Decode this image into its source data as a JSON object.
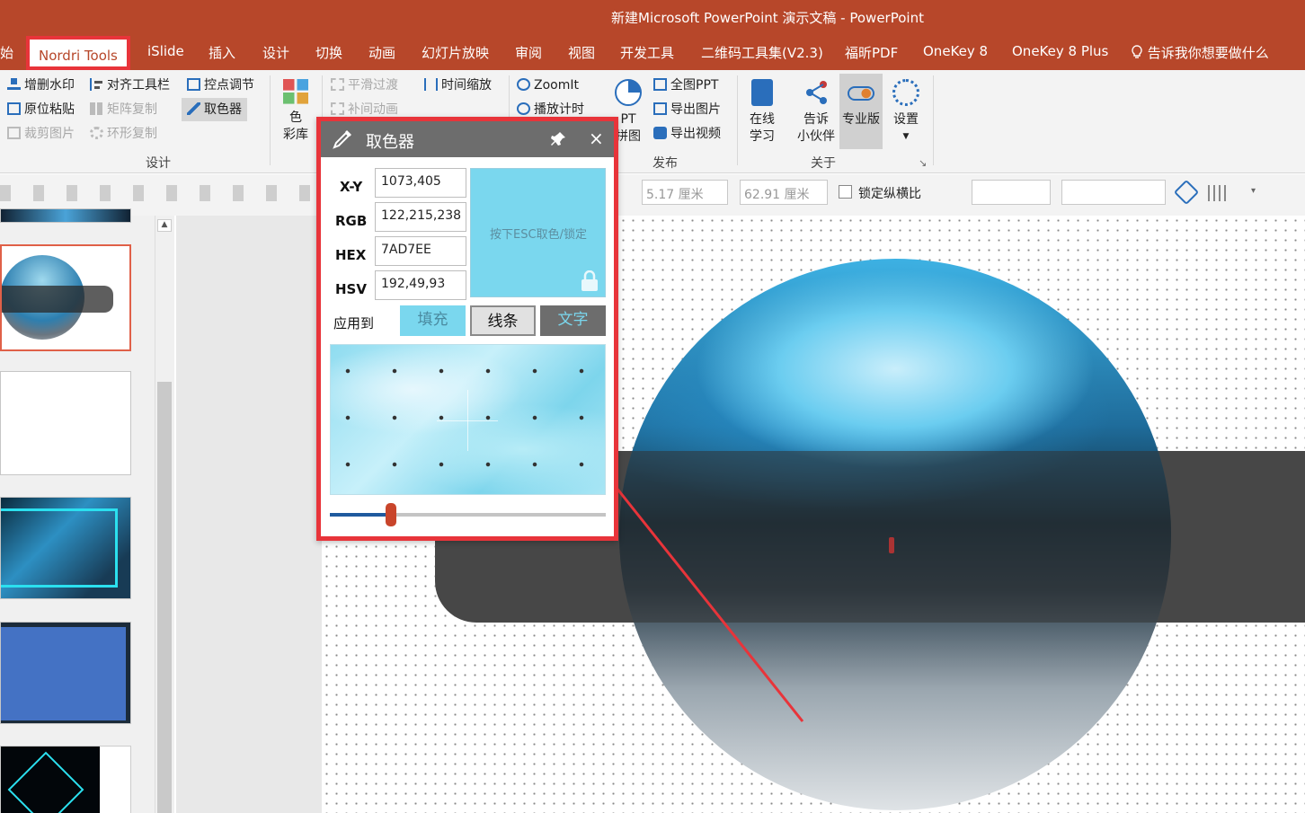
{
  "window": {
    "title": "新建Microsoft PowerPoint 演示文稿  -  PowerPoint"
  },
  "tabs": [
    "始",
    "Nordri Tools",
    "iSlide",
    "插入",
    "设计",
    "切换",
    "动画",
    "幻灯片放映",
    "审阅",
    "视图",
    "开发工具",
    "二维码工具集(V2.3)",
    "福昕PDF",
    "OneKey 8",
    "OneKey 8 Plus"
  ],
  "tell_me": "告诉我你想要做什么",
  "ribbon": {
    "design_col1": [
      "增删水印",
      "原位粘贴",
      "裁剪图片"
    ],
    "design_col2": [
      "对齐工具栏",
      "矩阵复制",
      "环形复制"
    ],
    "design_col3": [
      "控点调节",
      "取色器"
    ],
    "color_lib": [
      "色",
      "彩库"
    ],
    "design_group": "设计",
    "anim_col1": [
      "平滑过渡",
      "补间动画"
    ],
    "anim_col2": [
      "时间缩放"
    ],
    "zoom_col": [
      "ZoomIt",
      "播放计时"
    ],
    "ppt_big": [
      "PT",
      "拼图"
    ],
    "publish_col": [
      "全图PPT",
      "导出图片",
      "导出视频"
    ],
    "publish_group": "发布",
    "about_buttons": [
      [
        "在线",
        "学习"
      ],
      [
        "告诉",
        "小伙伴"
      ],
      [
        "专业版"
      ],
      [
        "设置"
      ]
    ],
    "about_group": "关于"
  },
  "toolbar2": {
    "width": "5.17 厘米",
    "height": "62.91 厘米",
    "lock_ratio": "锁定纵横比"
  },
  "picker": {
    "title": "取色器",
    "rows": [
      {
        "label": "X-Y",
        "value": "1073,405"
      },
      {
        "label": "RGB",
        "value": "122,215,238"
      },
      {
        "label": "HEX",
        "value": "7AD7EE"
      },
      {
        "label": "HSV",
        "value": "192,49,93"
      }
    ],
    "swatch_hint": "按下ESC取色/锁定",
    "swatch_color": "#7AD7EE",
    "apply_label": "应用到",
    "apply_buttons": [
      "填充",
      "线条",
      "文字"
    ],
    "zoom_slider": 0.22
  },
  "colors": {
    "accent": "#b7472a",
    "highlight": "#e8343a"
  }
}
